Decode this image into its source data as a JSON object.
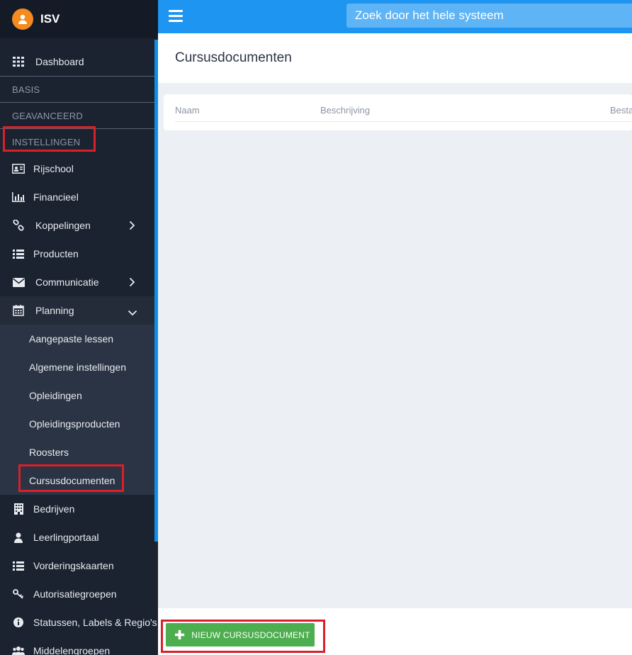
{
  "app": {
    "name": "ISV"
  },
  "search": {
    "placeholder": "Zoek door het hele systeem"
  },
  "sidebar": {
    "dashboard": "Dashboard",
    "sections": {
      "basis": "BASIS",
      "geavanceerd": "GEAVANCEERD",
      "instellingen": "INSTELLINGEN"
    },
    "items": [
      {
        "label": "Rijschool",
        "icon": "id-card-icon"
      },
      {
        "label": "Financieel",
        "icon": "bar-chart-icon"
      },
      {
        "label": "Koppelingen",
        "icon": "link-icon"
      },
      {
        "label": "Producten",
        "icon": "list-icon"
      },
      {
        "label": "Communicatie",
        "icon": "envelope-icon"
      },
      {
        "label": "Planning",
        "icon": "calendar-icon"
      }
    ],
    "planning_sub": [
      "Aangepaste lessen",
      "Algemene instellingen",
      "Opleidingen",
      "Opleidingsproducten",
      "Roosters",
      "Cursusdocumenten"
    ],
    "items_after": [
      {
        "label": "Bedrijven",
        "icon": "building-icon"
      },
      {
        "label": "Leerlingportaal",
        "icon": "user-icon"
      },
      {
        "label": "Vorderingskaarten",
        "icon": "list-icon"
      },
      {
        "label": "Autorisatiegroepen",
        "icon": "key-icon"
      },
      {
        "label": "Statussen, Labels & Regio's",
        "icon": "info-icon"
      },
      {
        "label": "Middelengroepen",
        "icon": "users-icon"
      }
    ]
  },
  "page": {
    "title": "Cursusdocumenten"
  },
  "table": {
    "columns": [
      "Naam",
      "Beschrijving",
      "Besta"
    ]
  },
  "actions": {
    "new_label": "NIEUW CURSUSDOCUMENT"
  },
  "colors": {
    "accent": "#1e95f0",
    "sidebar": "#1b2330",
    "button": "#4cae4f",
    "highlight": "#d9202a"
  }
}
